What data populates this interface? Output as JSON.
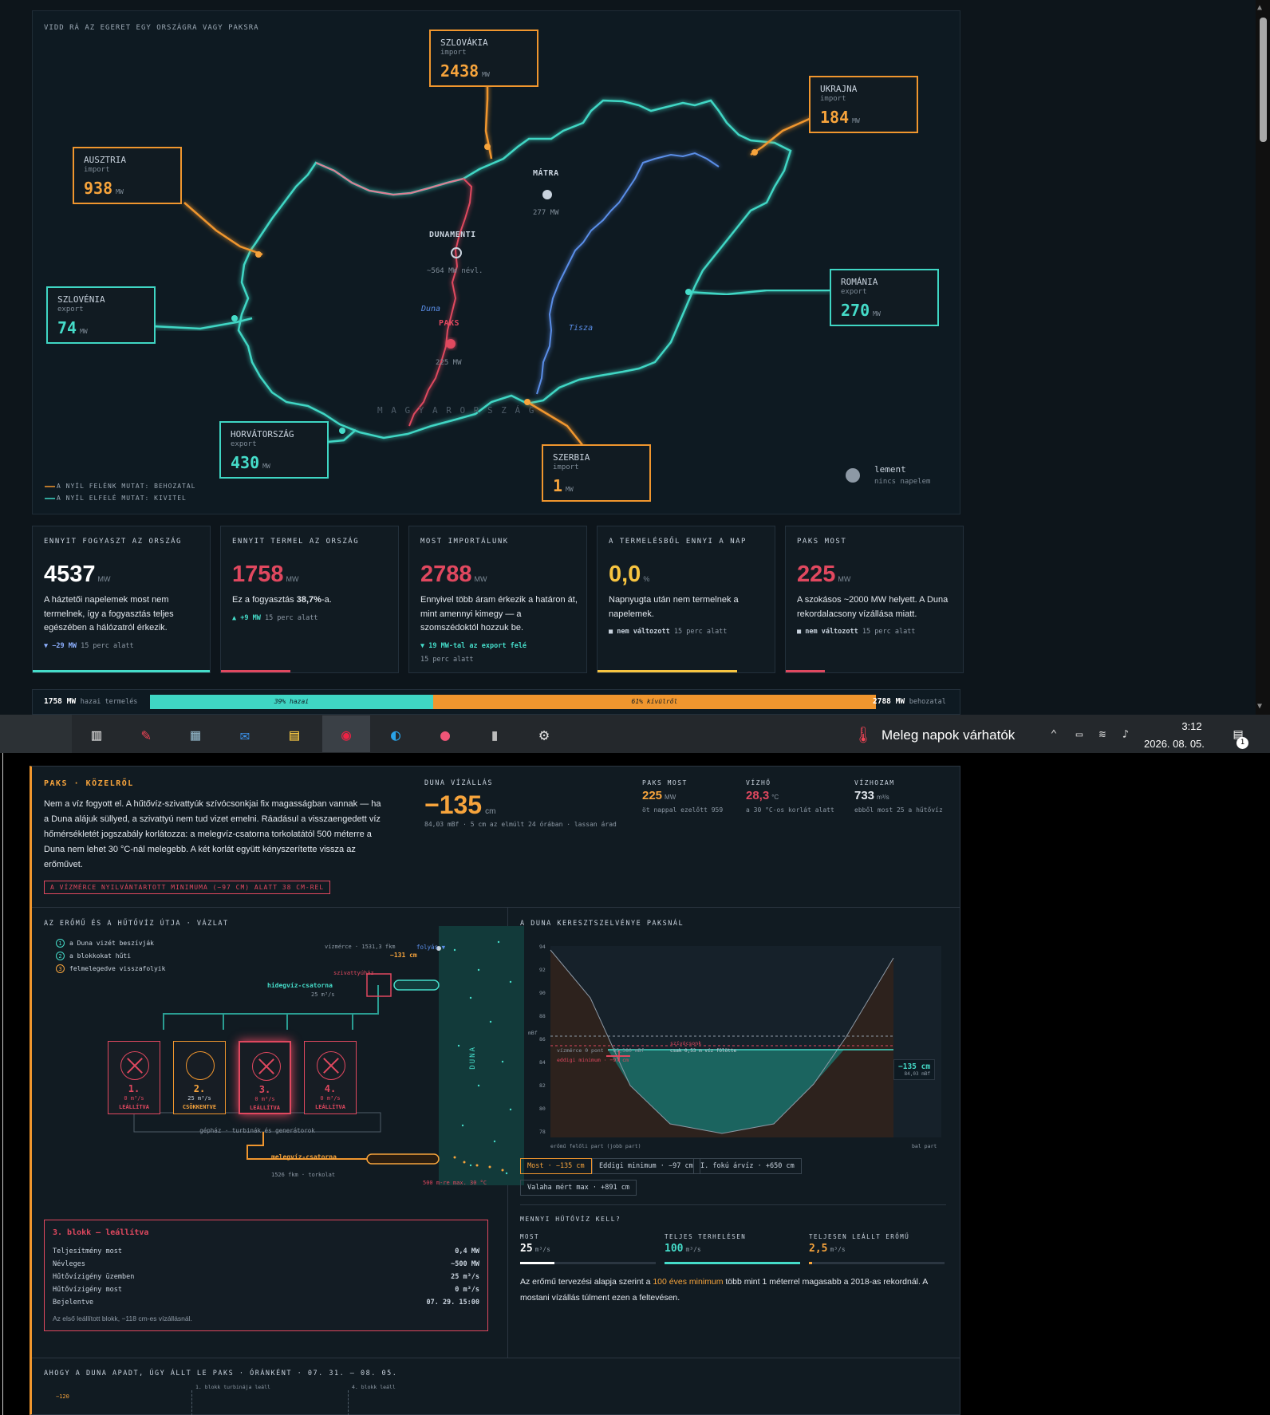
{
  "map": {
    "hint": "VIDD RÁ AZ EGERET EGY ORSZÁGRA VAGY PAKSRA",
    "countries": [
      {
        "name": "SZLOVÁKIA",
        "type": "import",
        "value": "2438",
        "unit": "MW"
      },
      {
        "name": "UKRAJNA",
        "type": "import",
        "value": "184",
        "unit": "MW"
      },
      {
        "name": "AUSZTRIA",
        "type": "import",
        "value": "938",
        "unit": "MW"
      },
      {
        "name": "SZLOVÉNIA",
        "type": "export",
        "value": "74",
        "unit": "MW"
      },
      {
        "name": "ROMÁNIA",
        "type": "export",
        "value": "270",
        "unit": "MW"
      },
      {
        "name": "HORVÁTORSZÁG",
        "type": "export",
        "value": "430",
        "unit": "MW"
      },
      {
        "name": "SZERBIA",
        "type": "import",
        "value": "1",
        "unit": "MW"
      }
    ],
    "plants": {
      "matra": "MÁTRA",
      "matra_mw": "277 MW",
      "dunamenti": "DUNAMENTI",
      "dunamenti_mw": "~564 MW névl.",
      "paks": "PAKS",
      "paks_mw": "225 MW"
    },
    "rivers": {
      "duna": "Duna",
      "tisza": "Tisza"
    },
    "country_label": "M A G Y A R O R S Z Á G",
    "legend": {
      "import": "A NYÍL FELÉNK MUTAT: BEHOZATAL",
      "export": "A NYÍL ELFELÉ MUTAT: KIVITEL"
    },
    "sun": {
      "title": "lement",
      "sub": "nincs napelem"
    },
    "colors": {
      "import": "#f0962e",
      "export": "#3fd6c4",
      "paks": "#e0485f"
    }
  },
  "cards": [
    {
      "label": "ENNYIT FOGYASZT AZ ORSZÁG",
      "value": "4537",
      "unit": "MW",
      "text": "A háztetői napelemek most nem termelnek, így a fogyasztás teljes egészében a hálózatról érkezik.",
      "change": "▼ −29 MW",
      "change_rest": "15 perc alatt"
    },
    {
      "label": "ENNYIT TERMEL AZ ORSZÁG",
      "value": "1758",
      "unit": "MW",
      "text_pre": "Ez a fogyasztás ",
      "text_bold": "38,7%",
      "text_post": "-a.",
      "change": "▲ +9 MW",
      "change_rest": "15 perc alatt"
    },
    {
      "label": "MOST IMPORTÁLUNK",
      "value": "2788",
      "unit": "MW",
      "text": "Ennyivel több áram érkezik a határon át, mint amennyi kimegy — a szomszédoktól hozzuk be.",
      "change": "▼ 19 MW-tal az export felé",
      "change_rest": "15 perc alatt"
    },
    {
      "label": "A TERMELÉSBŐL ENNYI A NAP",
      "value": "0,0",
      "unit": "%",
      "text": "Napnyugta után nem termelnek a napelemek.",
      "change": "■ nem változott",
      "change_rest": "15 perc alatt"
    },
    {
      "label": "PAKS MOST",
      "value": "225",
      "unit": "MW",
      "text": "A szokásos ~2000 MW helyett. A Duna rekordalacsony vízállása miatt.",
      "change": "■ nem változott",
      "change_rest": "15 perc alatt"
    }
  ],
  "stripe": {
    "left_value": "1758 MW",
    "left_label": "hazai termelés",
    "bar_home": "39% hazai",
    "bar_foreign": "61% kívülről",
    "home_pct": 39,
    "right_value": "2788 MW",
    "right_label": "behozatal"
  },
  "taskbar": {
    "weather": "Meleg napok várhatók",
    "time": "3:12",
    "date": "2026. 08. 05.",
    "notif": "1"
  },
  "paks": {
    "title": "PAKS · KÖZELRŐL",
    "text": "Nem a víz fogyott el. A hűtővíz-szivattyúk szívócsonkjai fix magasságban vannak — ha a Duna alájuk süllyed, a szivattyú nem tud vizet emelni. Ráadásul a visszaengedett víz hőmérsékletét jogszabály korlátozza: a melegvíz-csatorna torkolatától 500 méterre a Duna nem lehet 30 °C-nál melegebb. A két korlát együtt kényszerítette vissza az erőművet.",
    "alert": "A VÍZMÉRCE NYILVÁNTARTOTT MINIMUMA (−97 CM) ALATT 38 CM-REL",
    "level_label": "DUNA VÍZÁLLÁS",
    "level_value": "−135",
    "level_unit": "cm",
    "level_sub": "84,03 mBf · 5 cm az elmúlt 24 órában · lassan árad",
    "stats": [
      {
        "label": "PAKS MOST",
        "value": "225",
        "unit": "MW",
        "sub": "öt nappal ezelőtt 959",
        "color": "#f7a43c"
      },
      {
        "label": "VÍZHŐ",
        "value": "28,3",
        "unit": "°C",
        "sub": "a 30 °C-os korlát alatt",
        "color": "#e0485f"
      },
      {
        "label": "VÍZHOZAM",
        "value": "733",
        "unit": "m³/s",
        "sub": "ebből most 25 a hűtővíz",
        "color": "#e3e8ee"
      }
    ]
  },
  "schema": {
    "title": "AZ ERŐMŰ ÉS A HŰTŐVÍZ ÚTJA · VÁZLAT",
    "steps": [
      "a Duna vizét beszívják",
      "a blokkokat hűti",
      "felmelegedve visszafolyik"
    ],
    "gauge": "vízmérce · 1531,3 fkm",
    "gauge_val": "−131 cm",
    "flow": "folyás ▼",
    "pumphouse": "szivattyúház",
    "cold": "hidegvíz-csatorna",
    "cold_flow": "25 m³/s",
    "blocks": [
      {
        "n": "1.",
        "flow": "0 m³/s",
        "state": "LEÁLLÍTVA",
        "kind": "off"
      },
      {
        "n": "2.",
        "flow": "25 m³/s",
        "state": "CSÖKKENTVE",
        "kind": "reduced"
      },
      {
        "n": "3.",
        "flow": "0 m³/s",
        "state": "LEÁLLÍTVA",
        "kind": "off"
      },
      {
        "n": "4.",
        "flow": "0 m³/s",
        "state": "LEÁLLÍTVA",
        "kind": "off"
      }
    ],
    "hall": "gépház · turbinák és generátorok",
    "warm": "melegvíz-csatorna",
    "warm_sub": "1526 fkm · torkolat",
    "river": "DUNA",
    "limit": "500 m-re max. 30 °C"
  },
  "block_detail": {
    "title": "3. blokk — leállítva",
    "rows": [
      [
        "Teljesítmény most",
        "0,4 MW"
      ],
      [
        "Névleges",
        "~500 MW"
      ],
      [
        "Hűtővízigény üzemben",
        "25 m³/s"
      ],
      [
        "Hűtővízigény most",
        "0 m³/s"
      ],
      [
        "Bejelentve",
        "07. 29. 15:00"
      ]
    ],
    "note": "Az első leállított blokk, −118 cm-es vízállásnál."
  },
  "cross": {
    "title": "A DUNA KERESZTSZELVÉNYE PAKSNÁL",
    "yaxis": "mBf",
    "ticks": [
      "94",
      "92",
      "90",
      "88",
      "86",
      "84",
      "82",
      "80",
      "78"
    ],
    "zero": "vízmérce 0 pont · 85,380 mBf",
    "min": "eddigi minimum · −97 cm",
    "intake": "szívócsonk",
    "intake_sub": "csak 0,53 m víz fölötte",
    "now": "−135 cm",
    "now_sub": "84,03 mBf",
    "left": "erőmű felőli part (jobb part)",
    "right": "bal part",
    "buttons": [
      "Most · −135 cm",
      "Eddigi minimum · −97 cm",
      "I. fokú árvíz · +650 cm",
      "Valaha mért max · +891 cm"
    ]
  },
  "cooling": {
    "title": "MENNYI HŰTŐVÍZ KELL?",
    "items": [
      {
        "label": "MOST",
        "value": "25",
        "unit": "m³/s",
        "pct": 25,
        "color": "#ffffff"
      },
      {
        "label": "TELJES TERHELÉSEN",
        "value": "100",
        "unit": "m³/s",
        "pct": 100,
        "color": "#45dcc9"
      },
      {
        "label": "TELJESEN LEÁLLT ERŐMŰ",
        "value": "2,5",
        "unit": "m³/s",
        "pct": 2.5,
        "color": "#f7a43c"
      }
    ],
    "text_a": "Az erőmű tervezési alapja szerint a ",
    "text_b": "100 éves minimum",
    "text_c": " több mint 1 méterrel magasabb a 2018-as rekordnál. A mostani vízállás túlment ezen a feltevésen."
  },
  "timeline": {
    "title": "AHOGY A DUNA APADT, ÚGY ÁLLT LE PAKS · ÓRÁNKÉNT · 07. 31. – 08. 05.",
    "y": "−120",
    "ev1": "1. blokk turbinája leáll",
    "ev2": "4. blokk leáll"
  }
}
